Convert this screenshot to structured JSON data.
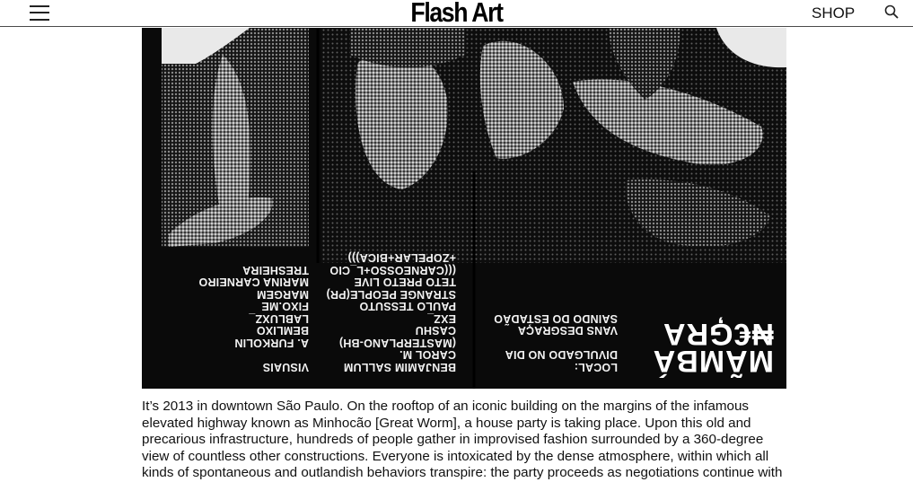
{
  "header": {
    "logo": "Flash Art",
    "shop_label": "SHOP",
    "menu_icon": "hamburger-menu-icon",
    "search_icon": "search-icon"
  },
  "poster": {
    "brand_line1": "MÃMBÁ",
    "brand_line2": "₦€ĢRA",
    "local_lines": [
      "LOCAL:",
      "DIVULGADO NO DIA",
      "",
      "VANS DESGRAÇA",
      "SAINDO DO ESTADÃO"
    ],
    "lineup_lines": [
      "BENJAMIM SALLUM",
      "CAROL M.",
      "(MASTERplano-BH)",
      "CASHU",
      "EXZ_",
      "PAULO TESSUTO",
      "STRANGE PEOPLE(PR)",
      "TETO PRETO LIVE",
      "(((CARNEOSSO+L_CIO",
      "+ZOPELAR+BICA)))"
    ],
    "visuais_heading": "VISUAIS",
    "visuais_lines": [
      "A. FURKOLIN",
      "BEMLIXO",
      "LabLUXZ_",
      "FIXO.me",
      "MARGEM",
      "MARINA CARNEIRO",
      "TRESHEIRA"
    ]
  },
  "article": {
    "paragraph": "It’s 2013 in downtown São Paulo. On the rooftop of an iconic building on the margins of the infamous elevated highway known as Minhocão [Great Worm], a house party is taking place. Upon this old and precarious infrastructure, hundreds of people gather in improvised fashion surrounded by a 360-degree view of countless other constructions. Everyone is intoxicated by the dense atmosphere, within which all kinds of spontaneous and outlandish behaviors transpire: the party proceeds as negotiations continue with"
  }
}
